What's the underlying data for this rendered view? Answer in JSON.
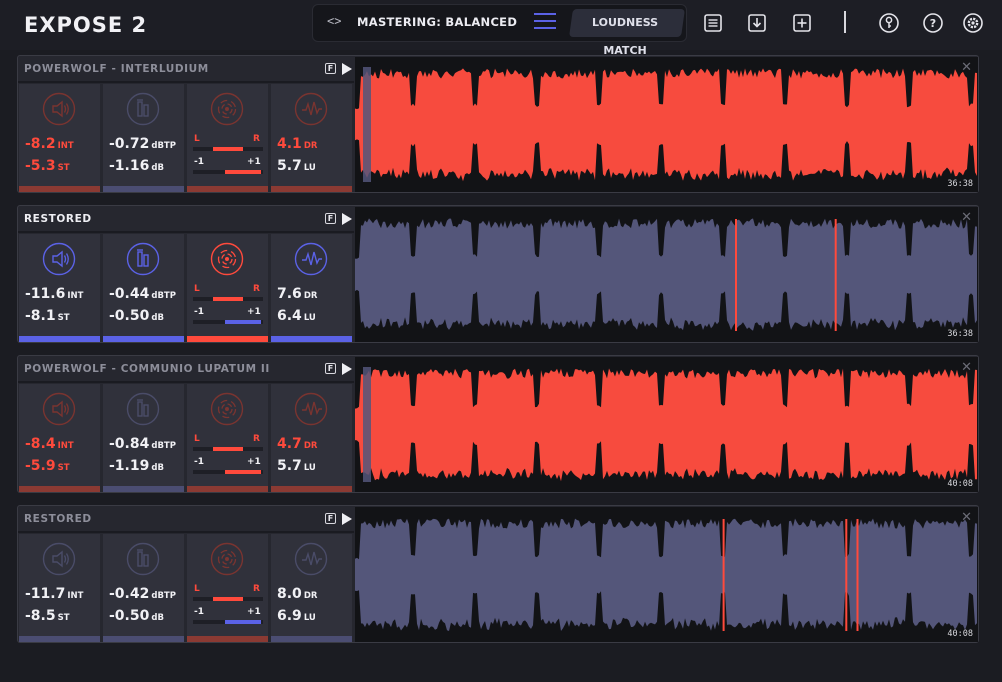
{
  "app": {
    "title": "EXPOSE 2"
  },
  "header": {
    "nav_arrows": "<>",
    "preset": "MASTERING: BALANCED",
    "loudness_match": "LOUDNESS MATCH",
    "icons": [
      "list-icon",
      "download-icon",
      "add-icon",
      "key-icon",
      "help-icon",
      "settings-icon"
    ]
  },
  "colors": {
    "accent_red": "#ff4a3c",
    "accent_blue": "#5b62e6",
    "wave_red": "#f74b3e",
    "wave_blue": "#54567a"
  },
  "tracks": [
    {
      "name": "POWERWOLF - INTERLUDIUM",
      "active": false,
      "wave_color": "red",
      "f_label": "F",
      "time": "36:38",
      "loudness": {
        "int": "-8.2",
        "int_unit": "INT",
        "st": "-5.3",
        "st_unit": "ST",
        "state": "red"
      },
      "peak": {
        "tp": "-0.72",
        "tp_unit": "dBTP",
        "db": "-1.16",
        "db_unit": "dB",
        "state": "blue"
      },
      "stereo": {
        "l": "L",
        "r": "R",
        "minus": "-1",
        "plus": "+1",
        "state": "red"
      },
      "dynamics": {
        "dr": "4.1",
        "dr_unit": "DR",
        "lu": "5.7",
        "lu_unit": "LU",
        "state": "red"
      },
      "markers": []
    },
    {
      "name": "RESTORED",
      "active": true,
      "wave_color": "blue",
      "f_label": "F",
      "time": "36:38",
      "loudness": {
        "int": "-11.6",
        "int_unit": "INT",
        "st": "-8.1",
        "st_unit": "ST",
        "state": "blue"
      },
      "peak": {
        "tp": "-0.44",
        "tp_unit": "dBTP",
        "db": "-0.50",
        "db_unit": "dB",
        "state": "blue"
      },
      "stereo": {
        "l": "L",
        "r": "R",
        "minus": "-1",
        "plus": "+1",
        "state": "red"
      },
      "dynamics": {
        "dr": "7.6",
        "dr_unit": "DR",
        "lu": "6.4",
        "lu_unit": "LU",
        "state": "blue"
      },
      "markers": [
        0.61,
        0.77
      ]
    },
    {
      "name": "POWERWOLF - COMMUNIO LUPATUM II",
      "active": false,
      "wave_color": "red",
      "f_label": "F",
      "time": "40:08",
      "loudness": {
        "int": "-8.4",
        "int_unit": "INT",
        "st": "-5.9",
        "st_unit": "ST",
        "state": "red"
      },
      "peak": {
        "tp": "-0.84",
        "tp_unit": "dBTP",
        "db": "-1.19",
        "db_unit": "dB",
        "state": "blue"
      },
      "stereo": {
        "l": "L",
        "r": "R",
        "minus": "-1",
        "plus": "+1",
        "state": "red"
      },
      "dynamics": {
        "dr": "4.7",
        "dr_unit": "DR",
        "lu": "5.7",
        "lu_unit": "LU",
        "state": "red"
      },
      "markers": []
    },
    {
      "name": "RESTORED",
      "active": false,
      "wave_color": "blue",
      "f_label": "F",
      "time": "40:08",
      "loudness": {
        "int": "-11.7",
        "int_unit": "INT",
        "st": "-8.5",
        "st_unit": "ST",
        "state": "blue"
      },
      "peak": {
        "tp": "-0.42",
        "tp_unit": "dBTP",
        "db": "-0.50",
        "db_unit": "dB",
        "state": "blue"
      },
      "stereo": {
        "l": "L",
        "r": "R",
        "minus": "-1",
        "plus": "+1",
        "state": "red"
      },
      "dynamics": {
        "dr": "8.0",
        "dr_unit": "DR",
        "lu": "6.9",
        "lu_unit": "LU",
        "state": "blue"
      },
      "markers": [
        0.59,
        0.787,
        0.805
      ]
    }
  ]
}
